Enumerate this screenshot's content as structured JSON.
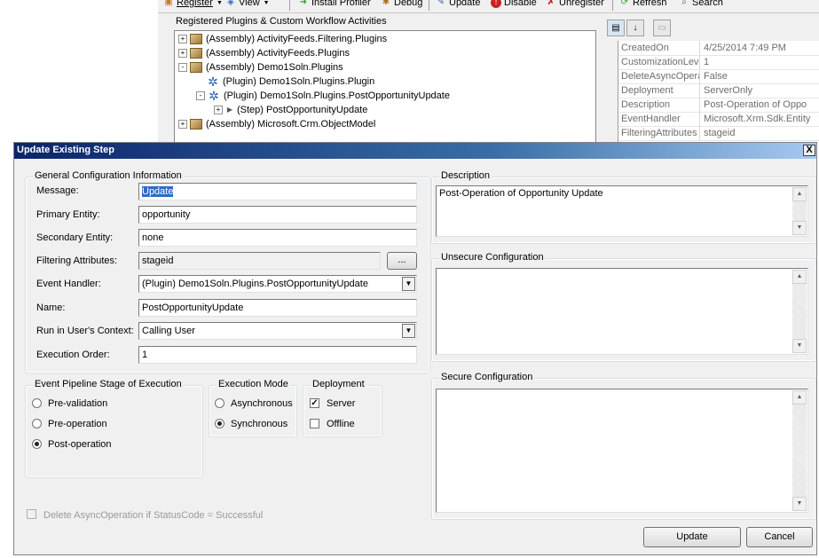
{
  "toolbar": {
    "items": [
      {
        "label": "Register",
        "icon": "register-icon",
        "dropdown": true
      },
      {
        "label": "View",
        "icon": "view-icon",
        "dropdown": true
      },
      {
        "label": "Install Profiler",
        "icon": "profiler-icon"
      },
      {
        "label": "Debug",
        "icon": "bug-icon"
      },
      {
        "label": "Update",
        "icon": "update-icon"
      },
      {
        "label": "Disable",
        "icon": "disable-icon"
      },
      {
        "label": "Unregister",
        "icon": "unregister-icon"
      },
      {
        "label": "Refresh",
        "icon": "refresh-icon"
      },
      {
        "label": "Search",
        "icon": "search-icon"
      }
    ]
  },
  "plugins_panel": {
    "title": "Registered Plugins & Custom Workflow Activities",
    "tree": [
      {
        "label": "(Assembly) ActivityFeeds.Filtering.Plugins",
        "type": "assembly",
        "expander": "+"
      },
      {
        "label": "(Assembly) ActivityFeeds.Plugins",
        "type": "assembly",
        "expander": "+"
      },
      {
        "label": "(Assembly) Demo1Soln.Plugins",
        "type": "assembly",
        "expander": "-"
      },
      {
        "label": "(Plugin) Demo1Soln.Plugins.Plugin",
        "type": "plugin",
        "expander": ""
      },
      {
        "label": "(Plugin) Demo1Soln.Plugins.PostOpportunityUpdate",
        "type": "plugin",
        "expander": "-"
      },
      {
        "label": "(Step) PostOpportunityUpdate",
        "type": "step",
        "expander": "+"
      },
      {
        "label": "(Assembly) Microsoft.Crm.ObjectModel",
        "type": "assembly",
        "expander": "+"
      }
    ]
  },
  "properties": {
    "rows": [
      {
        "name": "CreatedOn",
        "value": "4/25/2014 7:49 PM"
      },
      {
        "name": "CustomizationLevel",
        "value": "1"
      },
      {
        "name": "DeleteAsyncOperat",
        "value": "False"
      },
      {
        "name": "Deployment",
        "value": "ServerOnly"
      },
      {
        "name": "Description",
        "value": "Post-Operation of Oppo"
      },
      {
        "name": "EventHandler",
        "value": "Microsoft.Xrm.Sdk.Entity"
      },
      {
        "name": "FilteringAttributes",
        "value": "stageid"
      }
    ]
  },
  "dialog": {
    "title": "Update Existing Step",
    "close_glyph": "X",
    "general": {
      "legend": "General Configuration Information",
      "message_label": "Message:",
      "message_value": "Update",
      "primary_entity_label": "Primary Entity:",
      "primary_entity_value": "opportunity",
      "secondary_entity_label": "Secondary Entity:",
      "secondary_entity_value": "none",
      "filtering_label": "Filtering Attributes:",
      "filtering_value": "stageid",
      "filtering_button": "...",
      "event_handler_label": "Event Handler:",
      "event_handler_value": "(Plugin) Demo1Soln.Plugins.PostOpportunityUpdate",
      "name_label": "Name:",
      "name_value": "PostOpportunityUpdate",
      "run_context_label": "Run in User's Context:",
      "run_context_value": "Calling User",
      "execution_order_label": "Execution Order:",
      "execution_order_value": "1"
    },
    "stage": {
      "legend": "Event Pipeline Stage of Execution",
      "options": [
        "Pre-validation",
        "Pre-operation",
        "Post-operation"
      ],
      "selected": "Post-operation"
    },
    "mode": {
      "legend": "Execution Mode",
      "options": [
        "Asynchronous",
        "Synchronous"
      ],
      "selected": "Synchronous"
    },
    "deployment": {
      "legend": "Deployment",
      "server_label": "Server",
      "server_checked": true,
      "offline_label": "Offline",
      "offline_checked": false
    },
    "delete_async_label": "Delete AsyncOperation if StatusCode = Successful",
    "description": {
      "legend": "Description",
      "value": "Post-Operation of Opportunity Update"
    },
    "unsecure_legend": "Unsecure  Configuration",
    "secure_legend": "Secure Configuration",
    "update_button": "Update",
    "cancel_button": "Cancel"
  },
  "colors": {
    "titlebar_start": "#0a246a",
    "titlebar_end": "#a6caf0",
    "selection": "#316ac5"
  }
}
